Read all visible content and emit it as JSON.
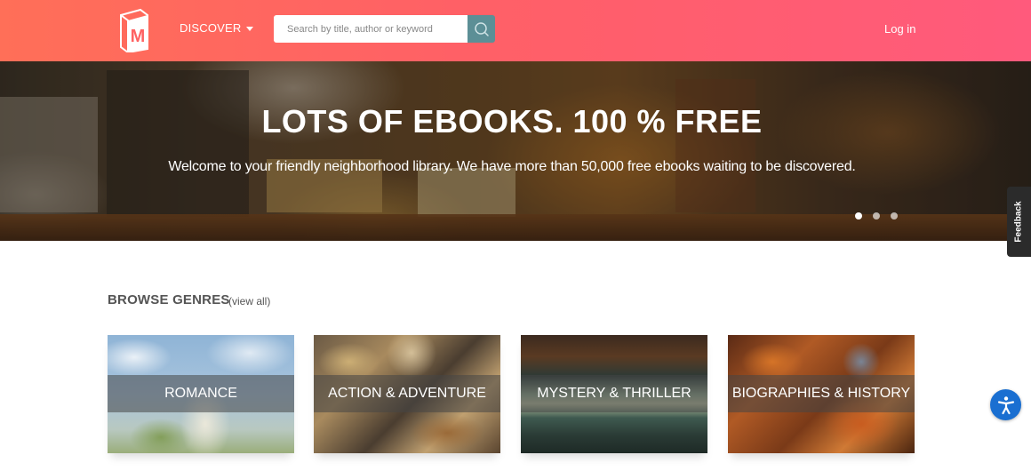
{
  "header": {
    "logo_letter": "M",
    "discover_label": "DISCOVER",
    "search_placeholder": "Search by title, author or keyword",
    "login_label": "Log in"
  },
  "hero": {
    "title": "LOTS OF EBOOKS. 100 % FREE",
    "subtitle": "Welcome to your friendly neighborhood library. We have more than 50,000 free ebooks waiting to be discovered.",
    "carousel_slides": 3,
    "active_slide": 1
  },
  "feedback": {
    "label": "Feedback"
  },
  "genres_section": {
    "title": "BROWSE GENRES",
    "view_all": "(view all)",
    "items": [
      {
        "label": "ROMANCE"
      },
      {
        "label": "ACTION & ADVENTURE"
      },
      {
        "label": "MYSTERY & THRILLER"
      },
      {
        "label": "BIOGRAPHIES & HISTORY"
      }
    ]
  },
  "colors": {
    "header_start": "#ff6f58",
    "header_end": "#ff5a7c",
    "search_button": "#5c8f96",
    "accessibility": "#1a6fd1"
  },
  "icons": {
    "logo": "book-logo-icon",
    "discover_caret": "caret-down-icon",
    "search": "search-icon",
    "accessibility": "accessibility-icon"
  }
}
